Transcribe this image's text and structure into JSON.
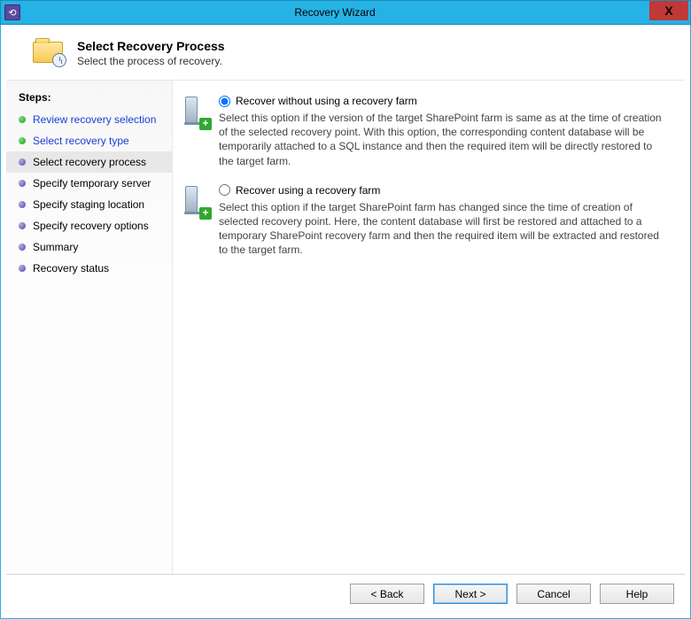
{
  "titlebar": {
    "title": "Recovery Wizard"
  },
  "header": {
    "title": "Select Recovery Process",
    "subtitle": "Select the process of recovery."
  },
  "sidebar": {
    "title": "Steps:",
    "steps": [
      {
        "label": "Review recovery selection",
        "state": "done"
      },
      {
        "label": "Select recovery type",
        "state": "done"
      },
      {
        "label": "Select recovery process",
        "state": "current"
      },
      {
        "label": "Specify temporary server",
        "state": "pending"
      },
      {
        "label": "Specify staging location",
        "state": "pending"
      },
      {
        "label": "Specify recovery options",
        "state": "pending"
      },
      {
        "label": "Summary",
        "state": "pending"
      },
      {
        "label": "Recovery status",
        "state": "pending"
      }
    ]
  },
  "options": [
    {
      "label": "Recover without using a recovery farm",
      "desc": "Select this option if the version of the target SharePoint farm is same as at the time of creation of the selected recovery point. With this option, the corresponding content database will be temporarily attached to a SQL instance and then the required item will be directly restored to the target farm.",
      "selected": true
    },
    {
      "label": "Recover using a recovery farm",
      "desc": "Select this option if the target SharePoint farm has changed since the time of creation of selected recovery point. Here, the content database will first be restored and attached to a temporary SharePoint recovery farm and then the required item will be extracted and restored to the target farm.",
      "selected": false
    }
  ],
  "buttons": {
    "back": "< Back",
    "next": "Next >",
    "cancel": "Cancel",
    "help": "Help"
  }
}
